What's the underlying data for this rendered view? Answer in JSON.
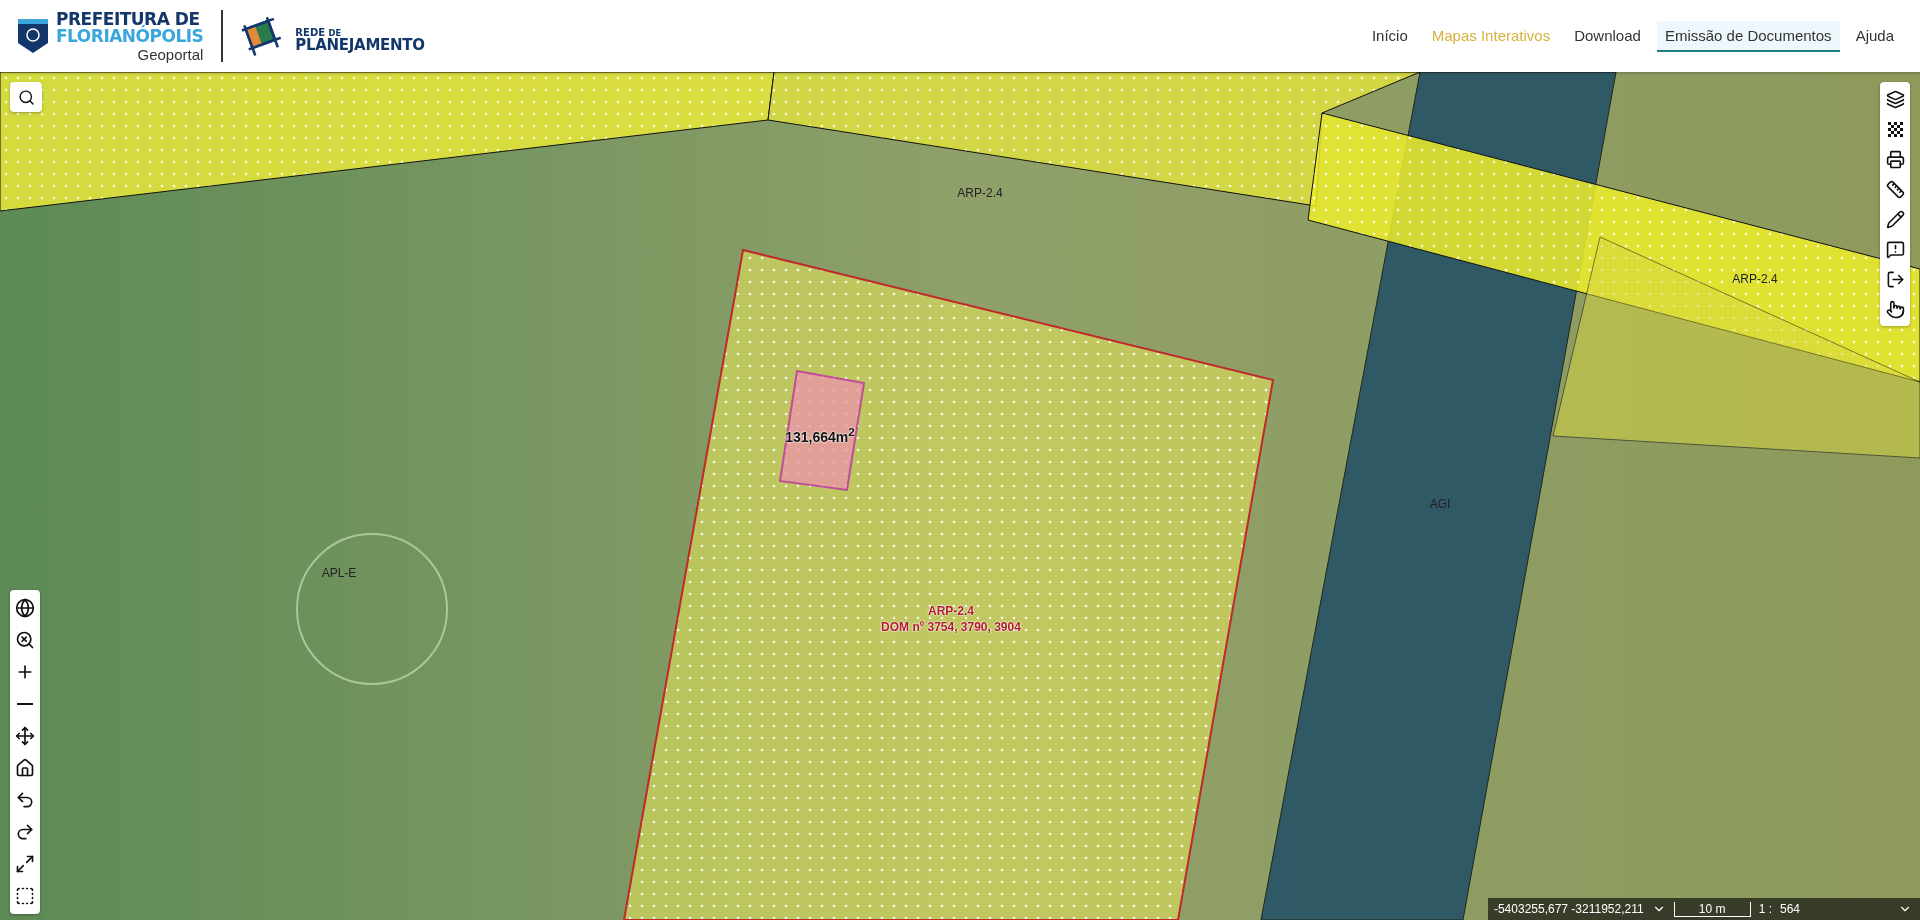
{
  "header": {
    "logo": {
      "line1": "PREFEITURA DE",
      "line2": "FLORIANÓPOLIS",
      "subtitle": "Geoportal"
    },
    "partner_logo": {
      "line1": "REDE",
      "line1_small": "DE",
      "line2": "PLANEJAMENTO"
    },
    "nav": [
      {
        "label": "Início",
        "active": false,
        "selected": false
      },
      {
        "label": "Mapas Interativos",
        "active": true,
        "selected": false
      },
      {
        "label": "Download",
        "active": false,
        "selected": false
      },
      {
        "label": "Emissão de Documentos",
        "active": false,
        "selected": true
      },
      {
        "label": "Ajuda",
        "active": false,
        "selected": false
      }
    ]
  },
  "map": {
    "labels": [
      {
        "kind": "zone",
        "text": "ARP-2.4"
      },
      {
        "kind": "zone",
        "text": "ARP-2.4"
      },
      {
        "kind": "zone",
        "text": "AGI"
      },
      {
        "kind": "zone",
        "text": "APL-E"
      },
      {
        "kind": "area",
        "text": "131,664m$^{2}$"
      },
      {
        "kind": "parcel",
        "text": "ARP-2.4"
      },
      {
        "kind": "parcel",
        "text": "DOM nº 3754, 3790, 3904"
      }
    ]
  },
  "status_bar": {
    "coordinates": "-5403255,677 -3211952,211",
    "scale_bar": "10 m",
    "scale_prefix": "1 :",
    "scale_value": "564"
  }
}
